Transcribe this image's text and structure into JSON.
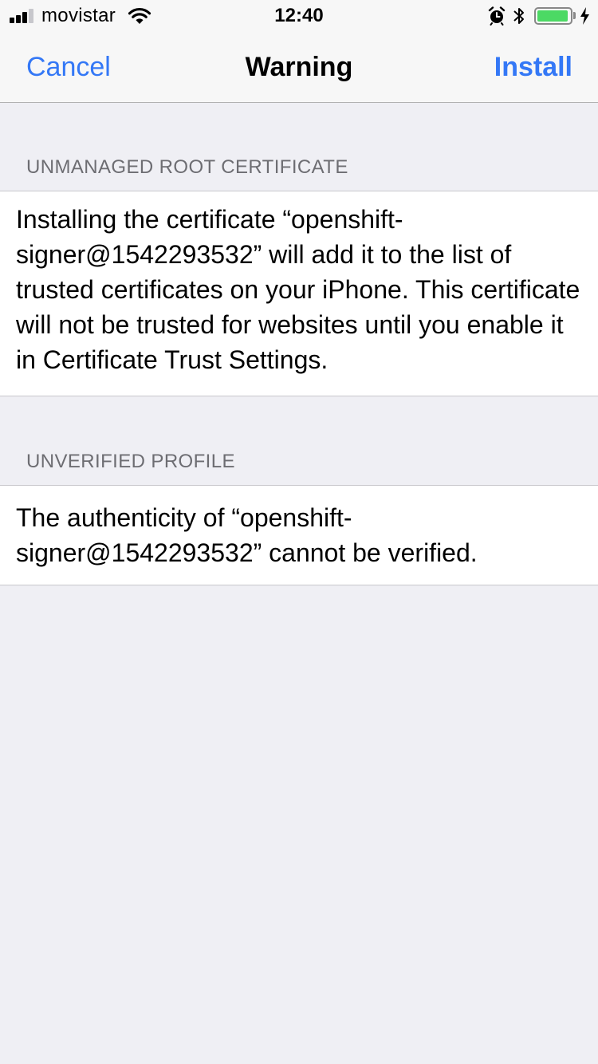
{
  "status_bar": {
    "carrier": "movistar",
    "time": "12:40",
    "signal_bars_active": 3,
    "signal_bars_total": 4,
    "battery_level": 0.95,
    "icons": [
      "signal-icon",
      "wifi-icon",
      "alarm-icon",
      "bluetooth-icon",
      "battery-icon",
      "charging-icon"
    ],
    "battery_color": "#4cd964"
  },
  "nav": {
    "cancel_label": "Cancel",
    "title": "Warning",
    "install_label": "Install",
    "accent_color": "#3478f6"
  },
  "sections": [
    {
      "header": "UNMANAGED ROOT CERTIFICATE",
      "body": "Installing the certificate “openshift-signer@1542293532” will add it to the list of trusted certificates on your iPhone. This certificate will not be trusted for websites until you enable it in Certificate Trust Settings."
    },
    {
      "header": "UNVERIFIED PROFILE",
      "body": "The authenticity of “openshift-signer@1542293532” cannot be verified."
    }
  ]
}
